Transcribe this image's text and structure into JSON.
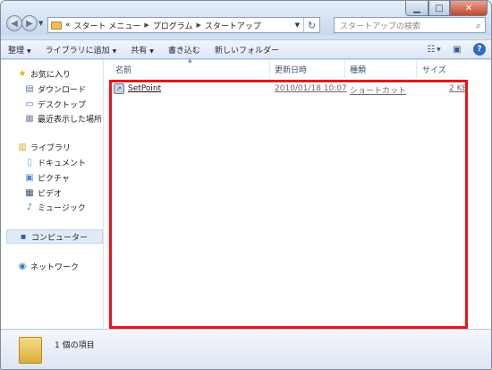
{
  "address": {
    "overflow": "«",
    "crumbs": [
      "スタート メニュー",
      "プログラム",
      "スタートアップ"
    ]
  },
  "search": {
    "placeholder": "スタートアップの検索"
  },
  "toolbar": {
    "organize": "整理",
    "add_to_library": "ライブラリに追加",
    "share": "共有",
    "burn": "書き込む",
    "new_folder": "新しいフォルダー"
  },
  "nav": {
    "favorites": "お気に入り",
    "downloads": "ダウンロード",
    "desktop": "デスクトップ",
    "recent": "最近表示した場所",
    "libraries": "ライブラリ",
    "documents": "ドキュメント",
    "pictures": "ピクチャ",
    "videos": "ビデオ",
    "music": "ミュージック",
    "computer": "コンピューター",
    "network": "ネットワーク"
  },
  "columns": {
    "name": "名前",
    "date": "更新日時",
    "type": "種類",
    "size": "サイズ"
  },
  "files": [
    {
      "name": "SetPoint",
      "date": "2010/01/18 10:07",
      "type": "ショートカット",
      "size": "2 KB"
    }
  ],
  "status": {
    "count_text": "1 個の項目"
  },
  "colors": {
    "highlight": "#e8141a",
    "selection": "#e1ebf7"
  }
}
